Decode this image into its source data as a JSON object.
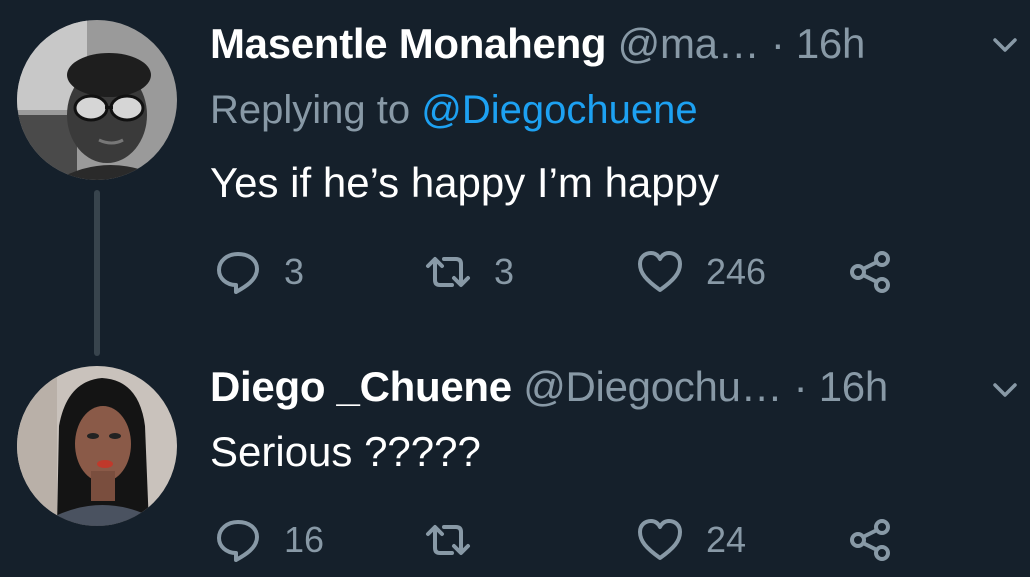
{
  "tweets": [
    {
      "name": "Masentle Monaheng",
      "handle": "@ma…",
      "dot": "·",
      "time": "16h",
      "replying_prefix": "Replying to",
      "replying_mention": "@Diegochuene",
      "text": "Yes if he’s happy I’m happy",
      "replies": "3",
      "retweets": "3",
      "likes": "246",
      "avatar": "woman-sunglasses-avatar"
    },
    {
      "name": "Diego _Chuene",
      "handle": "@Diegochu…",
      "dot": "·",
      "time": "16h",
      "text": "Serious ?????",
      "replies": "16",
      "retweets": "",
      "likes": "24",
      "avatar": "woman-dark-hair-avatar"
    }
  ],
  "icons": {
    "reply": "reply-icon",
    "retweet": "retweet-icon",
    "like": "heart-icon",
    "share": "share-icon",
    "menu": "chevron-down-icon"
  },
  "colors": {
    "background": "#15202b",
    "secondary_text": "#8899a6",
    "link": "#1da1f2",
    "thread_line": "#38444d"
  }
}
